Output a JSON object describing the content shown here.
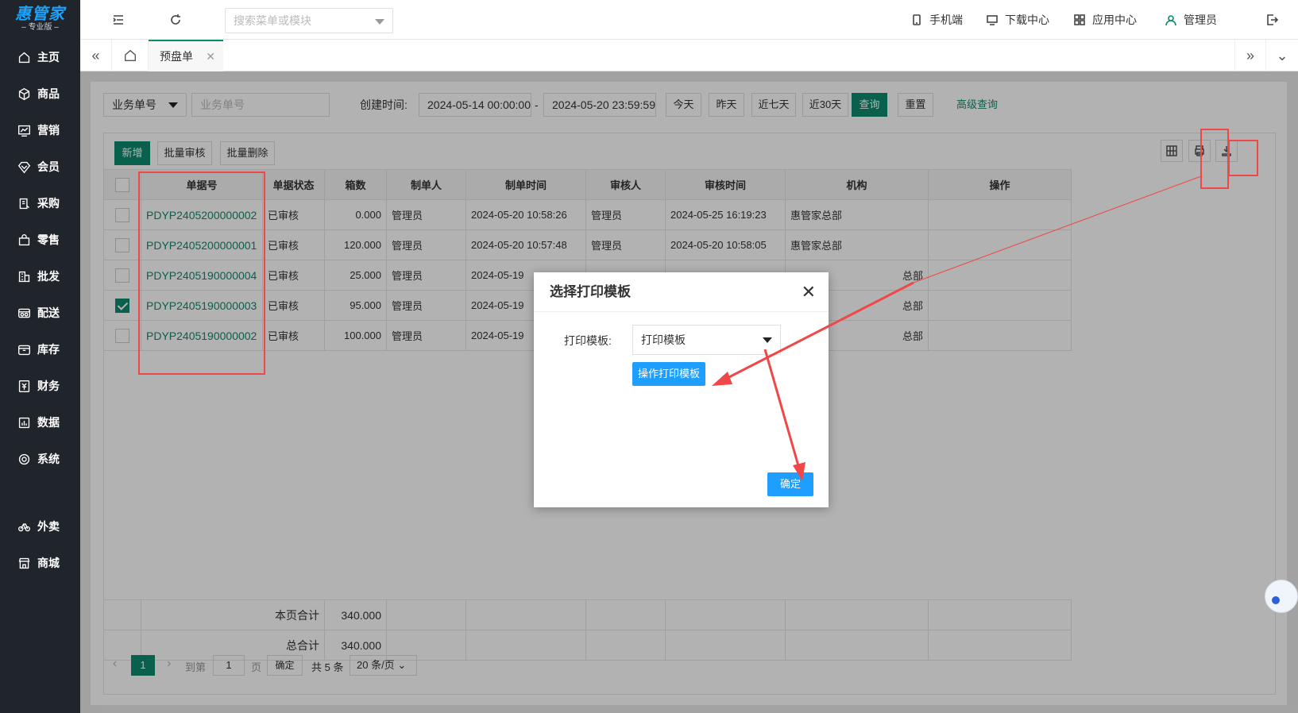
{
  "brand": {
    "name": "惠管家",
    "edition": "专业版"
  },
  "sidebar": {
    "items": [
      {
        "label": "主页",
        "icon": "home-icon"
      },
      {
        "label": "商品",
        "icon": "box-icon"
      },
      {
        "label": "营销",
        "icon": "chart-icon"
      },
      {
        "label": "会员",
        "icon": "diamond-icon"
      },
      {
        "label": "采购",
        "icon": "purchase-icon"
      },
      {
        "label": "零售",
        "icon": "bag-icon"
      },
      {
        "label": "批发",
        "icon": "building-icon"
      },
      {
        "label": "配送",
        "icon": "truck-icon"
      },
      {
        "label": "库存",
        "icon": "warehouse-icon"
      },
      {
        "label": "财务",
        "icon": "yen-icon"
      },
      {
        "label": "数据",
        "icon": "data-icon"
      },
      {
        "label": "系统",
        "icon": "settings-icon"
      },
      {
        "label": "外卖",
        "icon": "bike-icon"
      },
      {
        "label": "商城",
        "icon": "store-icon"
      }
    ]
  },
  "header": {
    "search_placeholder": "搜索菜单或模块",
    "links": [
      {
        "label": "手机端",
        "icon": "phone-icon"
      },
      {
        "label": "下载中心",
        "icon": "monitor-icon"
      },
      {
        "label": "应用中心",
        "icon": "apps-icon"
      },
      {
        "label": "管理员",
        "icon": "user-icon"
      }
    ]
  },
  "tabs": {
    "active": "预盘单"
  },
  "filters": {
    "field_select": "业务单号",
    "field_placeholder": "业务单号",
    "created_label": "创建时间:",
    "date_from": "2024-05-14 00:00:00",
    "date_sep": "-",
    "date_to": "2024-05-20 23:59:59",
    "quick": [
      "今天",
      "昨天",
      "近七天",
      "近30天"
    ],
    "query": "查询",
    "reset": "重置",
    "advanced": "高级查询"
  },
  "toolbar": {
    "add": "新增",
    "batch_audit": "批量审核",
    "batch_delete": "批量删除"
  },
  "table": {
    "headers": [
      "单据号",
      "单据状态",
      "箱数",
      "制单人",
      "制单时间",
      "审核人",
      "审核时间",
      "机构",
      "操作"
    ],
    "rows": [
      {
        "checked": false,
        "code": "PDYP2405200000002",
        "status": "已审核",
        "boxes": "0.000",
        "maker": "管理员",
        "made_at": "2024-05-20 10:58:26",
        "auditor": "管理员",
        "audited_at": "2024-05-25 16:19:23",
        "org": "惠管家总部"
      },
      {
        "checked": false,
        "code": "PDYP2405200000001",
        "status": "已审核",
        "boxes": "120.000",
        "maker": "管理员",
        "made_at": "2024-05-20 10:57:48",
        "auditor": "管理员",
        "audited_at": "2024-05-20 10:58:05",
        "org": "惠管家总部"
      },
      {
        "checked": false,
        "code": "PDYP2405190000004",
        "status": "已审核",
        "boxes": "25.000",
        "maker": "管理员",
        "made_at": "2024-05-19",
        "auditor": "",
        "audited_at": "",
        "org": "总部"
      },
      {
        "checked": true,
        "code": "PDYP2405190000003",
        "status": "已审核",
        "boxes": "95.000",
        "maker": "管理员",
        "made_at": "2024-05-19",
        "auditor": "",
        "audited_at": "",
        "org": "总部"
      },
      {
        "checked": false,
        "code": "PDYP2405190000002",
        "status": "已审核",
        "boxes": "100.000",
        "maker": "管理员",
        "made_at": "2024-05-19",
        "auditor": "",
        "audited_at": "",
        "org": "总部"
      }
    ],
    "page_total_label": "本页合计",
    "page_total": "340.000",
    "grand_total_label": "总合计",
    "grand_total": "340.000"
  },
  "pager": {
    "current": "1",
    "goto_label": "到第",
    "goto_value": "1",
    "page_unit": "页",
    "confirm": "确定",
    "total": "共 5 条",
    "size": "20 条/页"
  },
  "modal": {
    "title": "选择打印模板",
    "field_label": "打印模板:",
    "field_value": "打印模板",
    "operate_button": "操作打印模板",
    "confirm_button": "确定"
  },
  "colors": {
    "accent": "#0e8a6e",
    "blue": "#1e9fff",
    "annotation": "#f04848"
  }
}
